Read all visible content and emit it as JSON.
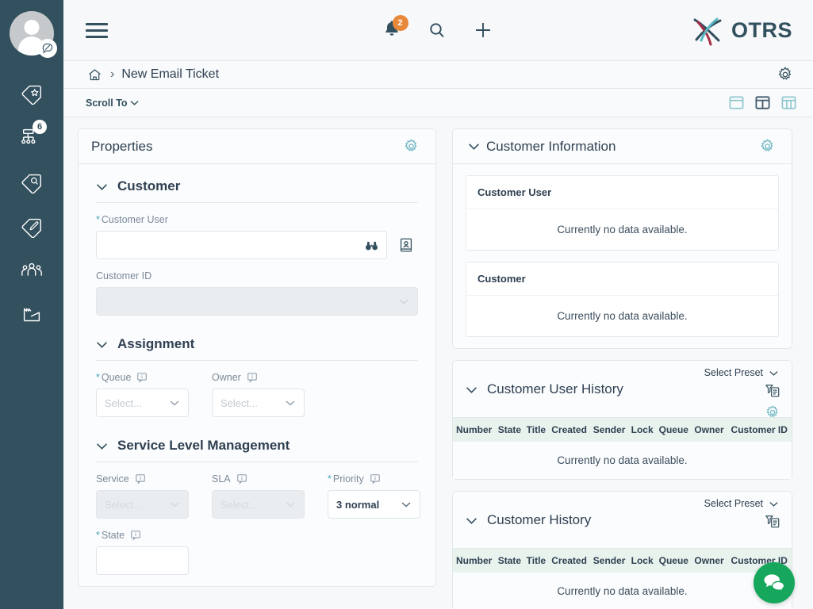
{
  "sidebar": {
    "avatar": {
      "name": "user-avatar",
      "badge_icon": "chat-disabled-icon"
    },
    "items": [
      {
        "icon": "tag-star-icon",
        "name": "sidebar-item-new-ticket",
        "badge": ""
      },
      {
        "icon": "queue-hierarchy-icon",
        "name": "sidebar-item-queues",
        "badge": "6"
      },
      {
        "icon": "tag-search-icon",
        "name": "sidebar-item-ticket-search",
        "badge": ""
      },
      {
        "icon": "tag-edit-icon",
        "name": "sidebar-item-ticket-edit",
        "badge": ""
      },
      {
        "icon": "customer-users-icon",
        "name": "sidebar-item-customer-users",
        "badge": ""
      },
      {
        "icon": "company-factory-icon",
        "name": "sidebar-item-customers",
        "badge": ""
      }
    ]
  },
  "header": {
    "menu_icon": "hamburger-icon",
    "notifications": {
      "icon": "bell-icon",
      "count": "2",
      "badge_color": "#e8883a"
    },
    "search_icon": "search-icon",
    "add_icon": "plus-icon",
    "logo_text": "OTRS",
    "logo_colors": {
      "dark": "#33505e",
      "teal": "#5bb7c4",
      "crimson": "#a32f45"
    },
    "settings_icon": "gear-icon"
  },
  "breadcrumb": {
    "home_icon": "home-icon",
    "separator": "›",
    "title": "New Email Ticket"
  },
  "toolbar": {
    "scroll_to_label": "Scroll To",
    "chevron_icon": "chevron-down-icon",
    "layouts": [
      {
        "name": "layout-one-column-icon",
        "active": false
      },
      {
        "name": "layout-two-column-icon",
        "active": true
      },
      {
        "name": "layout-three-column-icon",
        "active": false
      }
    ]
  },
  "properties": {
    "title": "Properties",
    "settings_icon": "gear-icon",
    "sections": [
      {
        "title": "Customer",
        "fields": [
          {
            "label": "Customer User",
            "required": true,
            "type": "text",
            "value": "",
            "placeholder": "",
            "inner_icon": "binoculars-icon",
            "side_button_icon": "address-book-icon"
          },
          {
            "label": "Customer ID",
            "required": false,
            "type": "select",
            "value": "",
            "placeholder": "",
            "disabled": true
          }
        ]
      },
      {
        "title": "Assignment",
        "fields": [
          {
            "label": "Queue",
            "required": true,
            "type": "select",
            "placeholder": "Select...",
            "info_icon": "info-bubble-icon",
            "disabled": false
          },
          {
            "label": "Owner",
            "required": false,
            "type": "select",
            "placeholder": "Select...",
            "info_icon": "info-bubble-icon",
            "disabled": false
          }
        ]
      },
      {
        "title": "Service Level Management",
        "fields": [
          {
            "label": "Service",
            "required": false,
            "type": "select",
            "placeholder": "Select...",
            "info_icon": "info-bubble-icon",
            "disabled": true
          },
          {
            "label": "SLA",
            "required": false,
            "type": "select",
            "placeholder": "Select...",
            "info_icon": "info-bubble-icon",
            "disabled": true
          },
          {
            "label": "Priority",
            "required": true,
            "type": "select",
            "value": "3 normal",
            "info_icon": "info-bubble-icon",
            "disabled": false
          },
          {
            "label": "State",
            "required": true,
            "type": "select",
            "placeholder": "",
            "info_icon": "info-bubble-icon",
            "disabled": false
          }
        ]
      }
    ]
  },
  "customer_information": {
    "title": "Customer Information",
    "settings_icon": "gear-icon",
    "collapse_icon": "chevron-down-icon",
    "cards": [
      {
        "heading": "Customer User",
        "body": "Currently no data available."
      },
      {
        "heading": "Customer",
        "body": "Currently no data available."
      }
    ]
  },
  "customer_user_history": {
    "title": "Customer User History",
    "preset_label": "Select Preset",
    "filter_icon": "filter-list-icon",
    "settings_icon": "gear-icon",
    "collapse_icon": "chevron-down-icon",
    "columns": [
      "Number",
      "State",
      "Title",
      "Created",
      "Sender",
      "Lock",
      "Queue",
      "Owner",
      "Customer ID"
    ],
    "empty_text": "Currently no data available."
  },
  "customer_history": {
    "title": "Customer History",
    "preset_label": "Select Preset",
    "filter_icon": "filter-list-icon",
    "settings_icon": "gear-icon",
    "collapse_icon": "chevron-down-icon",
    "columns": [
      "Number",
      "State",
      "Title",
      "Created",
      "Sender",
      "Lock",
      "Queue",
      "Owner",
      "Customer ID"
    ],
    "empty_text": "Currently no data available."
  },
  "chat_widget": {
    "icon": "chat-bubbles-icon",
    "color": "#16a75c"
  }
}
